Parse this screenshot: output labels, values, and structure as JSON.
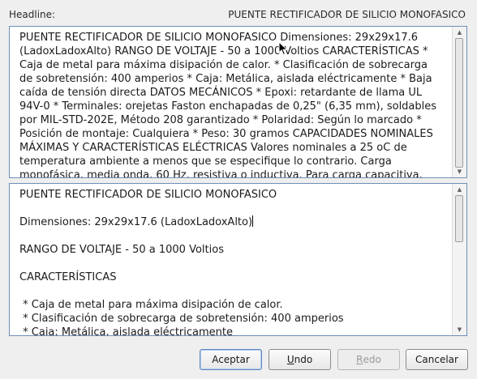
{
  "headline": {
    "label": "Headline:",
    "value": "PUENTE RECTIFICADOR DE SILICIO MONOFASICO"
  },
  "summary_text": "PUENTE RECTIFICADOR DE SILICIO MONOFASICO Dimensiones: 29x29x17.6 (LadoxLadoxAlto) RANGO DE VOLTAJE - 50 a 1000 Voltios CARACTERÍSTICAS * Caja de metal para máxima disipación de calor. * Clasificación de sobrecarga de sobretensión: 400 amperios * Caja: Metálica, aislada eléctricamente * Baja caída de tensión directa DATOS MECÁNICOS * Epoxi: retardante de llama UL 94V-0 * Terminales: orejetas Faston enchapadas de 0,25\" (6,35 mm), soldables por MIL-STD-202E, Método 208 garantizado * Polaridad: Según lo marcado * Posición de montaje: Cualquiera * Peso: 30 gramos CAPACIDADES NOMINALES MÁXIMAS Y CARACTERÍSTICAS ELÉCTRICAS Valores nominales a 25 oC de temperatura ambiente a menos que se especifique lo contrario. Carga monofásica, media onda, 60 Hz, resistiva o inductiva. Para carga capacitiva, reduzca la corriente en",
  "editor": {
    "line1": "PUENTE RECTIFICADOR DE SILICIO MONOFASICO",
    "line2": "Dimensiones: 29x29x17.6 (LadoxLadoxAlto)",
    "line3": "RANGO DE VOLTAJE - 50 a 1000 Voltios",
    "line4": "CARACTERÍSTICAS",
    "line5": " * Caja de metal para máxima disipación de calor.",
    "line6": " * Clasificación de sobrecarga de sobretensión: 400 amperios",
    "line7": " * Caja: Metálica, aislada eléctricamente"
  },
  "buttons": {
    "accept": "Aceptar",
    "undo_pre": "",
    "undo_mn": "U",
    "undo_post": "ndo",
    "redo_pre": "",
    "redo_mn": "R",
    "redo_post": "edo",
    "cancel": "Cancelar"
  },
  "icons": {
    "scroll_up": "▲",
    "scroll_down": "▼"
  },
  "colors": {
    "panel_border": "#6f8fb8",
    "default_button_border": "#5a86c0"
  }
}
